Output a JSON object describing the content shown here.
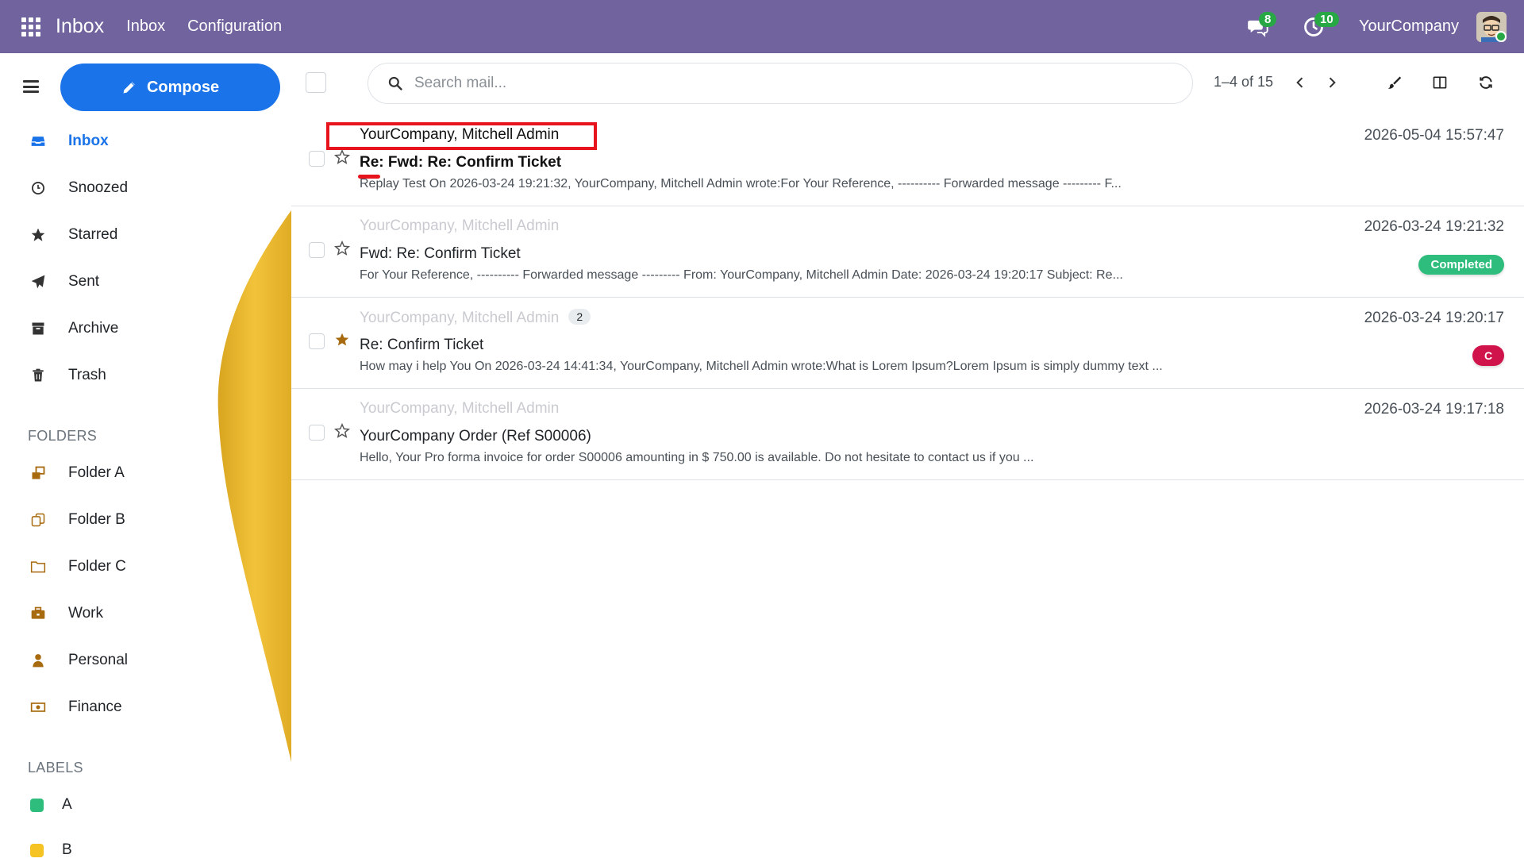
{
  "topbar": {
    "app_name": "Inbox",
    "menu": [
      "Inbox",
      "Configuration"
    ],
    "chat_count": "8",
    "activity_count": "10",
    "company": "YourCompany"
  },
  "compose": {
    "label": "Compose"
  },
  "nav": [
    {
      "label": "Inbox",
      "icon": "inbox-icon",
      "active": true
    },
    {
      "label": "Snoozed",
      "icon": "clock-icon"
    },
    {
      "label": "Starred",
      "icon": "star-icon"
    },
    {
      "label": "Sent",
      "icon": "paper-plane-icon"
    },
    {
      "label": "Archive",
      "icon": "archive-icon"
    },
    {
      "label": "Trash",
      "icon": "trash-icon"
    }
  ],
  "folders": {
    "title": "FOLDERS",
    "items": [
      {
        "label": "Folder A",
        "icon": "folder-a-icon"
      },
      {
        "label": "Folder B",
        "icon": "folder-b-icon"
      },
      {
        "label": "Folder C",
        "icon": "folder-open-icon"
      },
      {
        "label": "Work",
        "icon": "briefcase-icon"
      },
      {
        "label": "Personal",
        "icon": "user-icon"
      },
      {
        "label": "Finance",
        "icon": "money-icon"
      }
    ]
  },
  "labels": {
    "title": "LABELS",
    "items": [
      {
        "label": "A",
        "color": "#2ebd7c"
      },
      {
        "label": "B",
        "color": "#f6c324"
      }
    ]
  },
  "toolbar": {
    "search_placeholder": "Search mail...",
    "pager": "1–4 of 15"
  },
  "mails": [
    {
      "sender": "YourCompany, Mitchell Admin",
      "subject": "Re: Fwd: Re: Confirm Ticket",
      "preview": "Replay Test On 2026-03-24 19:21:32, YourCompany, Mitchell Admin wrote:For Your Reference, ---------- Forwarded message --------- F...",
      "date": "2026-05-04 15:57:47",
      "unread": true,
      "starred": false
    },
    {
      "sender": "YourCompany, Mitchell Admin",
      "subject": "Fwd: Re: Confirm Ticket",
      "preview": "For Your Reference, ---------- Forwarded message --------- From: YourCompany, Mitchell Admin Date: 2026-03-24 19:20:17 Subject: Re...",
      "date": "2026-03-24 19:21:32",
      "tag": "Completed",
      "starred": false
    },
    {
      "sender": "YourCompany, Mitchell Admin",
      "thread_count": "2",
      "subject": "Re: Confirm Ticket",
      "preview": "How may i help You On 2026-03-24 14:41:34, YourCompany, Mitchell Admin wrote:What is Lorem Ipsum?Lorem Ipsum is simply dummy text ...",
      "date": "2026-03-24 19:20:17",
      "tag": "C",
      "starred": true
    },
    {
      "sender": "YourCompany, Mitchell Admin",
      "subject": "YourCompany Order (Ref S00006)",
      "preview": "Hello, Your Pro forma invoice for order S00006 amounting in $ 750.00 is available. Do not hesitate to contact us if you ...",
      "date": "2026-03-24 19:17:18",
      "starred": false
    }
  ],
  "colors": {
    "navbar": "#71639e",
    "accent": "#1a73e8",
    "completed": "#2ebd7c",
    "tag_c": "#d0144b",
    "highlight": "#e8141d"
  }
}
